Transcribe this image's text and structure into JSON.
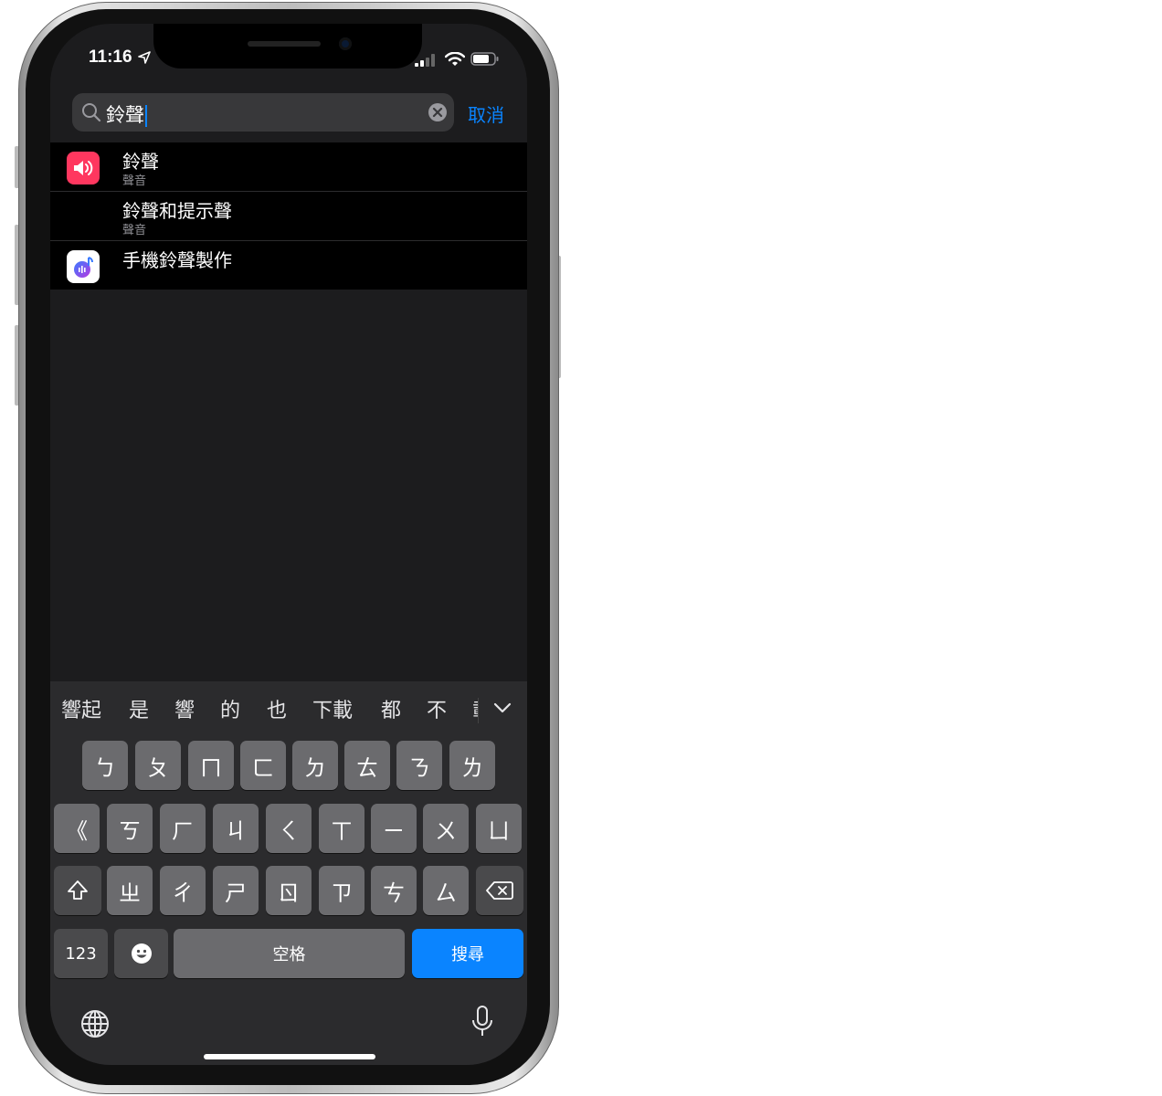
{
  "status_bar": {
    "time": "11:16"
  },
  "search": {
    "query": "鈴聲",
    "cancel_label": "取消"
  },
  "results": [
    {
      "title": "鈴聲",
      "subtitle": "聲音",
      "icon": "speaker-icon",
      "color": "#ff375f"
    },
    {
      "title": "鈴聲和提示聲",
      "subtitle": "聲音",
      "icon": "",
      "color": ""
    },
    {
      "title": "手機鈴聲製作",
      "subtitle": "",
      "icon": "ringtone-app-icon",
      "color": "#ffffff"
    }
  ],
  "keyboard": {
    "candidates": [
      "響起",
      "是",
      "響",
      "的",
      "也",
      "下載",
      "都",
      "不",
      "載"
    ],
    "row1": [
      "ㄅ",
      "ㄆ",
      "ㄇ",
      "ㄈ",
      "ㄉ",
      "ㄊ",
      "ㄋ",
      "ㄌ"
    ],
    "row2": [
      "《",
      "ㄎ",
      "ㄏ",
      "ㄐ",
      "ㄑ",
      "ㄒ",
      "ㄧ",
      "ㄨ",
      "ㄩ"
    ],
    "row3": [
      "ㄓ",
      "ㄔ",
      "ㄕ",
      "ㄖ",
      "ㄗ",
      "ㄘ",
      "ㄙ"
    ],
    "numbers_label": "123",
    "space_label": "空格",
    "search_label": "搜尋"
  },
  "colors": {
    "accent": "#0a84ff",
    "background": "#1c1c1e",
    "key": "#6b6b6e",
    "key_dark": "#4a4a4c"
  }
}
